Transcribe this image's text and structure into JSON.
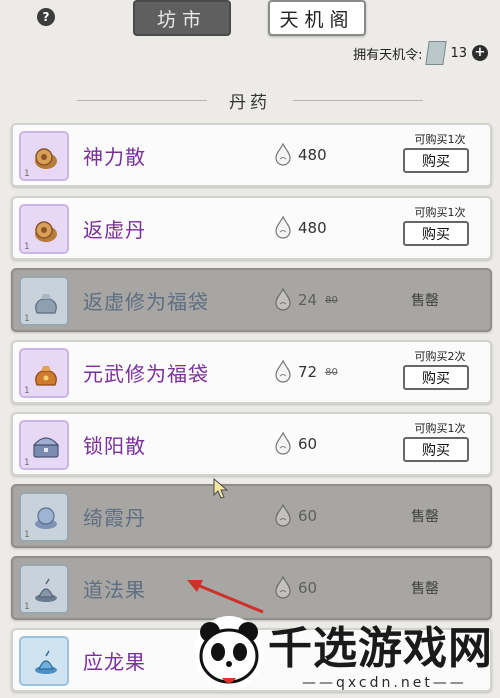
{
  "header": {
    "help_label": "?",
    "tabs": [
      {
        "label": "坊市",
        "active": true
      },
      {
        "label": "天机阁",
        "active": false
      }
    ],
    "token_label": "拥有天机令:",
    "token_count": "13",
    "plus_label": "+"
  },
  "section": {
    "title": "丹药"
  },
  "items": [
    {
      "name": "神力散",
      "price": "480",
      "orig_price": "",
      "limit": "可购买1次",
      "action": "购买",
      "qty": "1",
      "sold_out": false,
      "icon": "snail-icon"
    },
    {
      "name": "返虚丹",
      "price": "480",
      "orig_price": "",
      "limit": "可购买1次",
      "action": "购买",
      "qty": "1",
      "sold_out": false,
      "icon": "snail-icon"
    },
    {
      "name": "返虚修为福袋",
      "price": "24",
      "orig_price": "80",
      "limit": "",
      "action": "售罄",
      "qty": "1",
      "sold_out": true,
      "icon": "pouch-icon"
    },
    {
      "name": "元武修为福袋",
      "price": "72",
      "orig_price": "80",
      "limit": "可购买2次",
      "action": "购买",
      "qty": "1",
      "sold_out": false,
      "icon": "pouch-icon"
    },
    {
      "name": "锁阳散",
      "price": "60",
      "orig_price": "",
      "limit": "可购买1次",
      "action": "购买",
      "qty": "1",
      "sold_out": false,
      "icon": "chest-icon"
    },
    {
      "name": "绮霞丹",
      "price": "60",
      "orig_price": "",
      "limit": "",
      "action": "售罄",
      "qty": "1",
      "sold_out": true,
      "icon": "pill-icon"
    },
    {
      "name": "道法果",
      "price": "60",
      "orig_price": "",
      "limit": "",
      "action": "售罄",
      "qty": "1",
      "sold_out": true,
      "icon": "fruit-icon"
    },
    {
      "name": "应龙果",
      "price": "",
      "orig_price": "",
      "limit": "",
      "action": "",
      "qty": "",
      "sold_out": false,
      "icon": "fruit-icon"
    }
  ],
  "watermark": {
    "text": "千选游戏网",
    "url": "——qxcdn.net——"
  },
  "colors": {
    "name_purple": "#7b2f9b",
    "soldout_bg": "#a7a6a3",
    "arrow_red": "#d0302a"
  }
}
